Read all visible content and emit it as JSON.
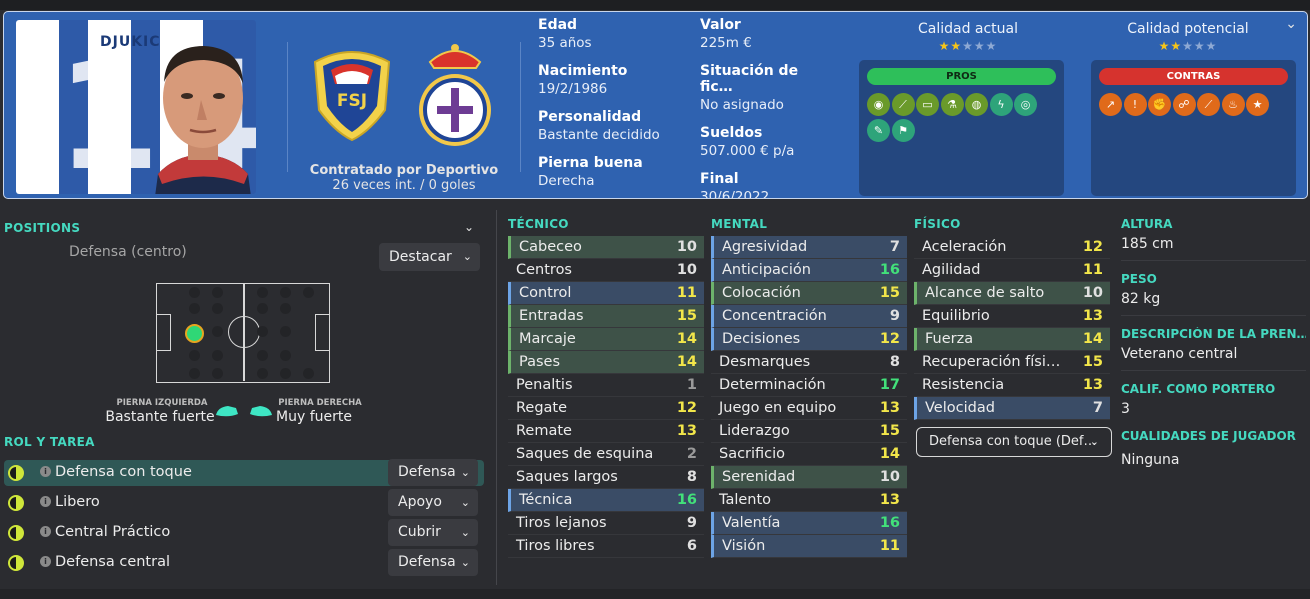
{
  "player": {
    "shirt_name": "DJUKIC",
    "shirt_number": "14"
  },
  "header": {
    "hired_by": "Contratado por Deportivo",
    "caps": "26 veces int. / 0 goles",
    "left": [
      {
        "label": "Edad",
        "value": "35 años"
      },
      {
        "label": "Nacimiento",
        "value": "19/2/1986"
      },
      {
        "label": "Personalidad",
        "value": "Bastante decidido"
      },
      {
        "label": "Pierna buena",
        "value": "Derecha"
      }
    ],
    "right": [
      {
        "label": "Valor",
        "value": "225m €"
      },
      {
        "label": "Situación de fic…",
        "value": "No asignado"
      },
      {
        "label": "Sueldos",
        "value": "507.000 € p/a"
      },
      {
        "label": "Final",
        "value": "30/6/2022"
      }
    ],
    "current_ability": {
      "label": "Calidad actual",
      "stars_filled": 2,
      "stars_total": 5
    },
    "potential_ability": {
      "label": "Calidad potencial",
      "stars_filled": 2,
      "stars_total": 5
    },
    "pros_label": "PROS",
    "contras_label": "CONTRAS",
    "pros_icons": [
      "brain-icon",
      "boot-icon",
      "pitch-icon",
      "flask-icon",
      "globe-icon",
      "lightning-icon",
      "target-icon",
      "wrench-icon",
      "flag-icon"
    ],
    "contras_icons": [
      "trend-icon",
      "ball-icon",
      "fists-icon",
      "runner-icon",
      "boot-icon",
      "fire-icon",
      "star-icon"
    ],
    "colors": {
      "header_bg": "#2f62b0",
      "pros": "#2ebf5a",
      "contras": "#d6332e",
      "accent": "#45d9c0"
    }
  },
  "positions": {
    "title": "POSITIONS",
    "position": "Defensa (centro)",
    "highlight": "Destacar",
    "left_foot_label": "PIERNA IZQUIERDA",
    "left_foot_value": "Bastante fuerte",
    "right_foot_label": "PIERNA DERECHA",
    "right_foot_value": "Muy fuerte"
  },
  "roles": {
    "title": "ROL Y TAREA",
    "items": [
      {
        "name": "Defensa con toque",
        "duty": "Defensa"
      },
      {
        "name": "Libero",
        "duty": "Apoyo"
      },
      {
        "name": "Central Práctico",
        "duty": "Cubrir"
      },
      {
        "name": "Defensa central",
        "duty": "Defensa"
      }
    ]
  },
  "attributes": {
    "tecnico": {
      "title": "TÉCNICO",
      "items": [
        {
          "n": "Cabeceo",
          "v": "10",
          "h": "g"
        },
        {
          "n": "Centros",
          "v": "10",
          "h": ""
        },
        {
          "n": "Control",
          "v": "11",
          "h": "b"
        },
        {
          "n": "Entradas",
          "v": "15",
          "h": "g"
        },
        {
          "n": "Marcaje",
          "v": "14",
          "h": "g"
        },
        {
          "n": "Pases",
          "v": "14",
          "h": "g"
        },
        {
          "n": "Penaltis",
          "v": "1",
          "h": ""
        },
        {
          "n": "Regate",
          "v": "12",
          "h": ""
        },
        {
          "n": "Remate",
          "v": "13",
          "h": ""
        },
        {
          "n": "Saques de esquina",
          "v": "2",
          "h": ""
        },
        {
          "n": "Saques largos",
          "v": "8",
          "h": ""
        },
        {
          "n": "Técnica",
          "v": "16",
          "h": "b"
        },
        {
          "n": "Tiros lejanos",
          "v": "9",
          "h": ""
        },
        {
          "n": "Tiros libres",
          "v": "6",
          "h": ""
        }
      ]
    },
    "mental": {
      "title": "MENTAL",
      "items": [
        {
          "n": "Agresividad",
          "v": "7",
          "h": "b"
        },
        {
          "n": "Anticipación",
          "v": "16",
          "h": "b"
        },
        {
          "n": "Colocación",
          "v": "15",
          "h": "g"
        },
        {
          "n": "Concentración",
          "v": "9",
          "h": "b"
        },
        {
          "n": "Decisiones",
          "v": "12",
          "h": "b"
        },
        {
          "n": "Desmarques",
          "v": "8",
          "h": ""
        },
        {
          "n": "Determinación",
          "v": "17",
          "h": ""
        },
        {
          "n": "Juego en equipo",
          "v": "13",
          "h": ""
        },
        {
          "n": "Liderazgo",
          "v": "15",
          "h": ""
        },
        {
          "n": "Sacrificio",
          "v": "14",
          "h": ""
        },
        {
          "n": "Serenidad",
          "v": "10",
          "h": "g"
        },
        {
          "n": "Talento",
          "v": "13",
          "h": ""
        },
        {
          "n": "Valentía",
          "v": "16",
          "h": "b"
        },
        {
          "n": "Visión",
          "v": "11",
          "h": "b"
        }
      ]
    },
    "fisico": {
      "title": "FÍSICO",
      "items": [
        {
          "n": "Aceleración",
          "v": "12",
          "h": ""
        },
        {
          "n": "Agilidad",
          "v": "11",
          "h": ""
        },
        {
          "n": "Alcance de salto",
          "v": "10",
          "h": "g"
        },
        {
          "n": "Equilibrio",
          "v": "13",
          "h": ""
        },
        {
          "n": "Fuerza",
          "v": "14",
          "h": "g"
        },
        {
          "n": "Recuperación físi…",
          "v": "15",
          "h": ""
        },
        {
          "n": "Resistencia",
          "v": "13",
          "h": ""
        },
        {
          "n": "Velocidad",
          "v": "7",
          "h": "b"
        }
      ]
    },
    "profile_dropdown": "Defensa con toque (Def…"
  },
  "info": [
    {
      "label": "ALTURA",
      "value": "185 cm"
    },
    {
      "label": "PESO",
      "value": "82 kg"
    },
    {
      "label": "DESCRIPCIÓN DE LA PREN…",
      "value": "Veterano central"
    },
    {
      "label": "CALIF. COMO PORTERO",
      "value": "3"
    },
    {
      "label": "CUALIDADES DE JUGADOR",
      "value": "Ninguna"
    }
  ]
}
